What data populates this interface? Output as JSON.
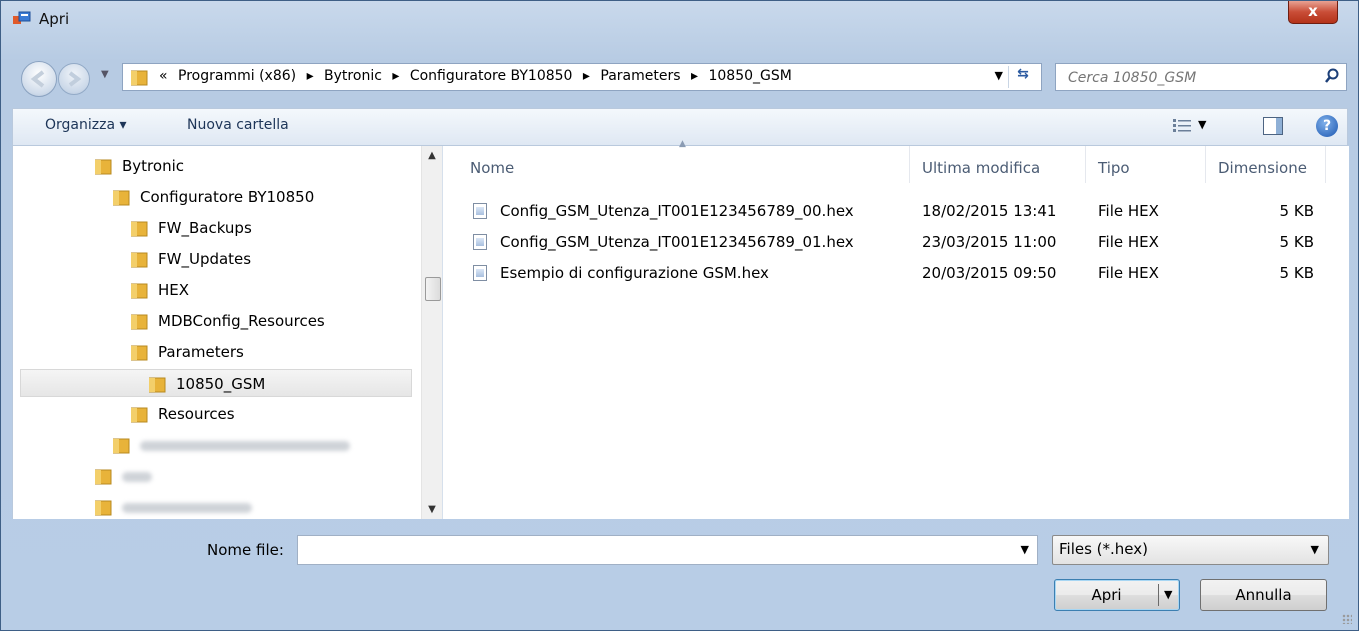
{
  "window": {
    "title": "Apri",
    "close_label": "x"
  },
  "address": {
    "prefix": "«",
    "crumbs": [
      "Programmi (x86)",
      "Bytronic",
      "Configuratore BY10850",
      "Parameters",
      "10850_GSM"
    ],
    "separator": "▸"
  },
  "search": {
    "placeholder": "Cerca 10850_GSM"
  },
  "toolbar": {
    "organize_label": "Organizza ▾",
    "new_folder_label": "Nuova cartella",
    "help_label": "?"
  },
  "tree": [
    {
      "label": "Bytronic",
      "indent": 1
    },
    {
      "label": "Configuratore BY10850",
      "indent": 2
    },
    {
      "label": "FW_Backups",
      "indent": 3
    },
    {
      "label": "FW_Updates",
      "indent": 3
    },
    {
      "label": "HEX",
      "indent": 3
    },
    {
      "label": "MDBConfig_Resources",
      "indent": 3
    },
    {
      "label": "Parameters",
      "indent": 3
    },
    {
      "label": "10850_GSM",
      "indent": 4,
      "selected": true
    },
    {
      "label": "Resources",
      "indent": 3
    },
    {
      "label": "",
      "indent": 2,
      "blurred": true
    },
    {
      "label": "",
      "indent": 1,
      "blurred": true
    },
    {
      "label": "",
      "indent": 1,
      "blurred": true
    }
  ],
  "columns": {
    "name": "Nome",
    "modified": "Ultima modifica",
    "type": "Tipo",
    "size": "Dimensione"
  },
  "files": [
    {
      "name": "Config_GSM_Utenza_IT001E123456789_00.hex",
      "modified": "18/02/2015 13:41",
      "type": "File HEX",
      "size": "5 KB"
    },
    {
      "name": "Config_GSM_Utenza_IT001E123456789_01.hex",
      "modified": "23/03/2015 11:00",
      "type": "File HEX",
      "size": "5 KB"
    },
    {
      "name": "Esempio di configurazione GSM.hex",
      "modified": "20/03/2015 09:50",
      "type": "File HEX",
      "size": "5 KB"
    }
  ],
  "bottom": {
    "filename_label": "Nome file:",
    "filename_value": "",
    "filetype_value": "Files (*.hex)",
    "open_label": "Apri",
    "cancel_label": "Annulla"
  },
  "colors": {
    "folder": "#e8b33a",
    "title_bg": "#c9d9ec",
    "close_red": "#c94d37",
    "selection": "#e6e6e6"
  }
}
